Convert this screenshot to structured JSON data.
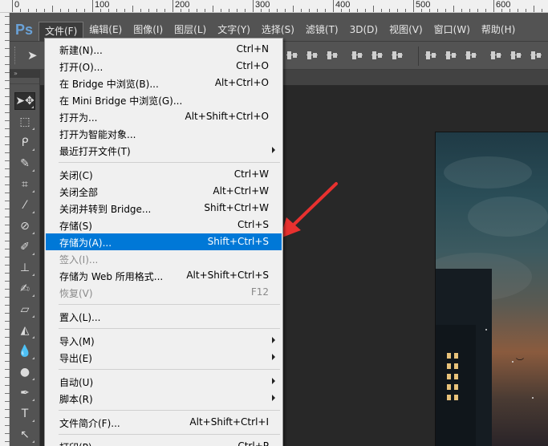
{
  "ruler": {
    "top_labels": [
      "0",
      "100",
      "200",
      "300",
      "400",
      "500",
      "600"
    ]
  },
  "app": {
    "logo": "Ps"
  },
  "menubar": {
    "items": [
      "文件(F)",
      "编辑(E)",
      "图像(I)",
      "图层(L)",
      "文字(Y)",
      "选择(S)",
      "滤镜(T)",
      "3D(D)",
      "视图(V)",
      "窗口(W)",
      "帮助(H)"
    ],
    "active_index": 0
  },
  "toolpanel": {
    "header": "»",
    "tools": [
      {
        "icon": "move-tool-icon",
        "glyph": "➤✥"
      },
      {
        "icon": "marquee-tool-icon",
        "glyph": "⬚"
      },
      {
        "icon": "lasso-tool-icon",
        "glyph": "ᑭ"
      },
      {
        "icon": "quick-selection-tool-icon",
        "glyph": "✎"
      },
      {
        "icon": "crop-tool-icon",
        "glyph": "⌗"
      },
      {
        "icon": "eyedropper-tool-icon",
        "glyph": "⁄"
      },
      {
        "icon": "healing-brush-tool-icon",
        "glyph": "⊘"
      },
      {
        "icon": "brush-tool-icon",
        "glyph": "✐"
      },
      {
        "icon": "clone-stamp-tool-icon",
        "glyph": "⊥"
      },
      {
        "icon": "history-brush-tool-icon",
        "glyph": "✍"
      },
      {
        "icon": "eraser-tool-icon",
        "glyph": "▱"
      },
      {
        "icon": "paint-bucket-tool-icon",
        "glyph": "◭"
      },
      {
        "icon": "blur-tool-icon",
        "glyph": "💧"
      },
      {
        "icon": "dodge-tool-icon",
        "glyph": "●"
      },
      {
        "icon": "pen-tool-icon",
        "glyph": "✒"
      },
      {
        "icon": "type-tool-icon",
        "glyph": "T"
      },
      {
        "icon": "path-selection-tool-icon",
        "glyph": "↖"
      }
    ]
  },
  "file_menu": {
    "items": [
      {
        "type": "item",
        "label": "新建(N)...",
        "shortcut": "Ctrl+N"
      },
      {
        "type": "item",
        "label": "打开(O)...",
        "shortcut": "Ctrl+O"
      },
      {
        "type": "item",
        "label": "在 Bridge 中浏览(B)...",
        "shortcut": "Alt+Ctrl+O"
      },
      {
        "type": "item",
        "label": "在 Mini Bridge 中浏览(G)...",
        "shortcut": ""
      },
      {
        "type": "item",
        "label": "打开为...",
        "shortcut": "Alt+Shift+Ctrl+O"
      },
      {
        "type": "item",
        "label": "打开为智能对象...",
        "shortcut": ""
      },
      {
        "type": "item",
        "label": "最近打开文件(T)",
        "shortcut": "",
        "submenu": true
      },
      {
        "type": "separator"
      },
      {
        "type": "item",
        "label": "关闭(C)",
        "shortcut": "Ctrl+W"
      },
      {
        "type": "item",
        "label": "关闭全部",
        "shortcut": "Alt+Ctrl+W"
      },
      {
        "type": "item",
        "label": "关闭并转到 Bridge...",
        "shortcut": "Shift+Ctrl+W"
      },
      {
        "type": "item",
        "label": "存储(S)",
        "shortcut": "Ctrl+S"
      },
      {
        "type": "item",
        "label": "存储为(A)...",
        "shortcut": "Shift+Ctrl+S",
        "highlight": true
      },
      {
        "type": "item",
        "label": "签入(I)...",
        "shortcut": "",
        "disabled": true
      },
      {
        "type": "item",
        "label": "存储为 Web 所用格式...",
        "shortcut": "Alt+Shift+Ctrl+S"
      },
      {
        "type": "item",
        "label": "恢复(V)",
        "shortcut": "F12",
        "disabled": true
      },
      {
        "type": "separator"
      },
      {
        "type": "item",
        "label": "置入(L)...",
        "shortcut": ""
      },
      {
        "type": "separator"
      },
      {
        "type": "item",
        "label": "导入(M)",
        "shortcut": "",
        "submenu": true
      },
      {
        "type": "item",
        "label": "导出(E)",
        "shortcut": "",
        "submenu": true
      },
      {
        "type": "separator"
      },
      {
        "type": "item",
        "label": "自动(U)",
        "shortcut": "",
        "submenu": true
      },
      {
        "type": "item",
        "label": "脚本(R)",
        "shortcut": "",
        "submenu": true
      },
      {
        "type": "separator"
      },
      {
        "type": "item",
        "label": "文件简介(F)...",
        "shortcut": "Alt+Shift+Ctrl+I"
      },
      {
        "type": "separator"
      },
      {
        "type": "item",
        "label": "打印(P)...",
        "shortcut": "Ctrl+P"
      }
    ]
  },
  "colors": {
    "highlight": "#0078d7",
    "annotation_arrow": "#e8312f"
  }
}
